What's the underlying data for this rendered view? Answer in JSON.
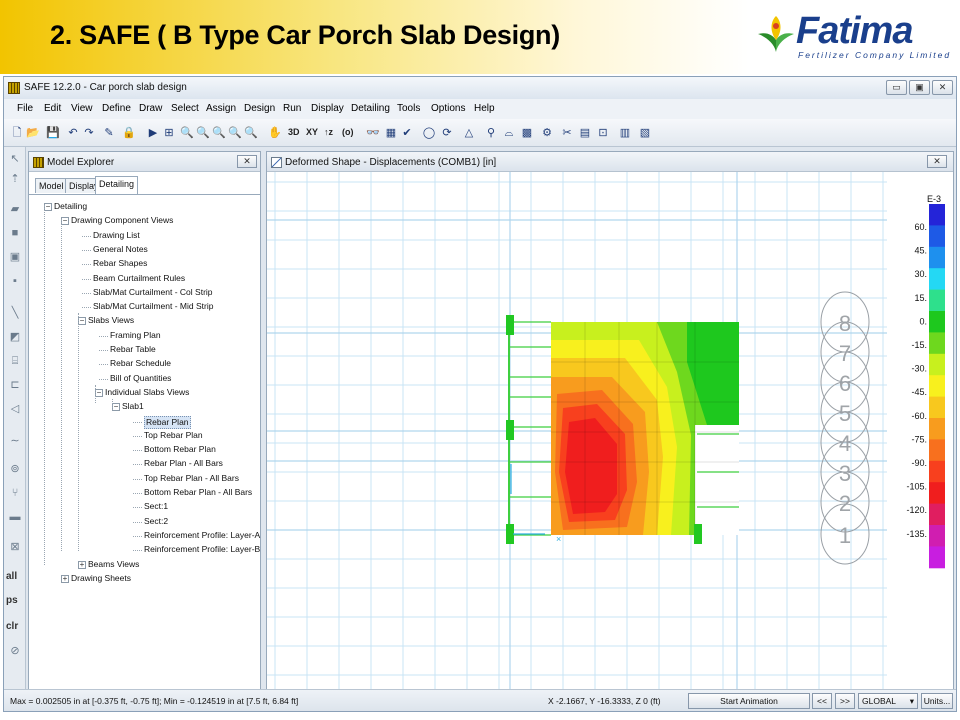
{
  "slide": {
    "title": "2. SAFE ( B Type Car Porch Slab Design)",
    "logo_word": "Fatima",
    "logo_sub": "Fertilizer Company Limited"
  },
  "window": {
    "title": "SAFE 12.2.0 - Car porch slab design",
    "controls": [
      "▭",
      "▣",
      "✕"
    ]
  },
  "menu": [
    "File",
    "Edit",
    "View",
    "Define",
    "Draw",
    "Select",
    "Assign",
    "Design",
    "Run",
    "Display",
    "Detailing",
    "Tools",
    "Options",
    "Help"
  ],
  "toolbar": {
    "text_buttons": [
      "3D",
      "XY",
      "↑z",
      "(o)"
    ]
  },
  "left_tools": {
    "labels": [
      "all",
      "ps",
      "clr"
    ]
  },
  "explorer": {
    "title": "Model Explorer",
    "close": "✕",
    "tabs": [
      "Model",
      "Display",
      "Detailing"
    ],
    "active_tab": "Detailing",
    "tree": [
      {
        "label": "Detailing",
        "level": 0,
        "expander": "−"
      },
      {
        "label": "Drawing Component Views",
        "level": 1,
        "expander": "−"
      },
      {
        "label": "Drawing List",
        "level": 2
      },
      {
        "label": "General Notes",
        "level": 2
      },
      {
        "label": "Rebar Shapes",
        "level": 2
      },
      {
        "label": "Beam Curtailment Rules",
        "level": 2
      },
      {
        "label": "Slab/Mat Curtailment - Col Strip",
        "level": 2
      },
      {
        "label": "Slab/Mat Curtailment - Mid Strip",
        "level": 2
      },
      {
        "label": "Slabs Views",
        "level": 2,
        "expander": "−"
      },
      {
        "label": "Framing Plan",
        "level": 3
      },
      {
        "label": "Rebar Table",
        "level": 3
      },
      {
        "label": "Rebar Schedule",
        "level": 3
      },
      {
        "label": "Bill of Quantities",
        "level": 3
      },
      {
        "label": "Individual Slabs Views",
        "level": 3,
        "expander": "−"
      },
      {
        "label": "Slab1",
        "level": 4,
        "expander": "−"
      },
      {
        "label": "Rebar Plan",
        "level": 5,
        "selected": true
      },
      {
        "label": "Top Rebar Plan",
        "level": 5
      },
      {
        "label": "Bottom Rebar Plan",
        "level": 5
      },
      {
        "label": "Rebar Plan - All Bars",
        "level": 5
      },
      {
        "label": "Top Rebar Plan - All Bars",
        "level": 5
      },
      {
        "label": "Bottom Rebar Plan - All Bars",
        "level": 5
      },
      {
        "label": "Sect:1",
        "level": 5
      },
      {
        "label": "Sect:2",
        "level": 5
      },
      {
        "label": "Reinforcement Profile: Layer-A",
        "level": 5
      },
      {
        "label": "Reinforcement Profile: Layer-B",
        "level": 5
      },
      {
        "label": "Beams Views",
        "level": 2,
        "expander": "+"
      },
      {
        "label": "Drawing Sheets",
        "level": 1,
        "expander": "+"
      }
    ]
  },
  "view": {
    "title": "Deformed Shape - Displacements (COMB1)  [in]",
    "close": "✕",
    "axis_bubbles": [
      "8",
      "7",
      "6",
      "5",
      "4",
      "3",
      "2",
      "1"
    ],
    "legend": {
      "exponent": "E-3",
      "ticks": [
        "60.",
        "45.",
        "30.",
        "15.",
        "0.",
        "-15.",
        "-30.",
        "-45.",
        "-60.",
        "-75.",
        "-90.",
        "-105.",
        "-120.",
        "-135."
      ],
      "colors": [
        "#2424d8",
        "#1e5ae6",
        "#1e90ee",
        "#24d8f4",
        "#2ee08c",
        "#1ec81e",
        "#6ed81e",
        "#c8f01e",
        "#f8f01e",
        "#f8c81e",
        "#f89c1e",
        "#f8701e",
        "#f8401e",
        "#f01e1e",
        "#e01e60",
        "#d01eb0",
        "#c81ee0"
      ]
    }
  },
  "status": {
    "left": "Max = 0.002505 in at [-0.375 ft, -0.75 ft];  Min = -0.124519 in at [7.5 ft, 6.84 ft]",
    "coords": "X -2.1667,  Y -16.3333,  Z 0  (ft)",
    "animation_button": "Start Animation",
    "prev": "<<",
    "next": ">>",
    "coord_system": "GLOBAL",
    "units_button": "Units..."
  }
}
